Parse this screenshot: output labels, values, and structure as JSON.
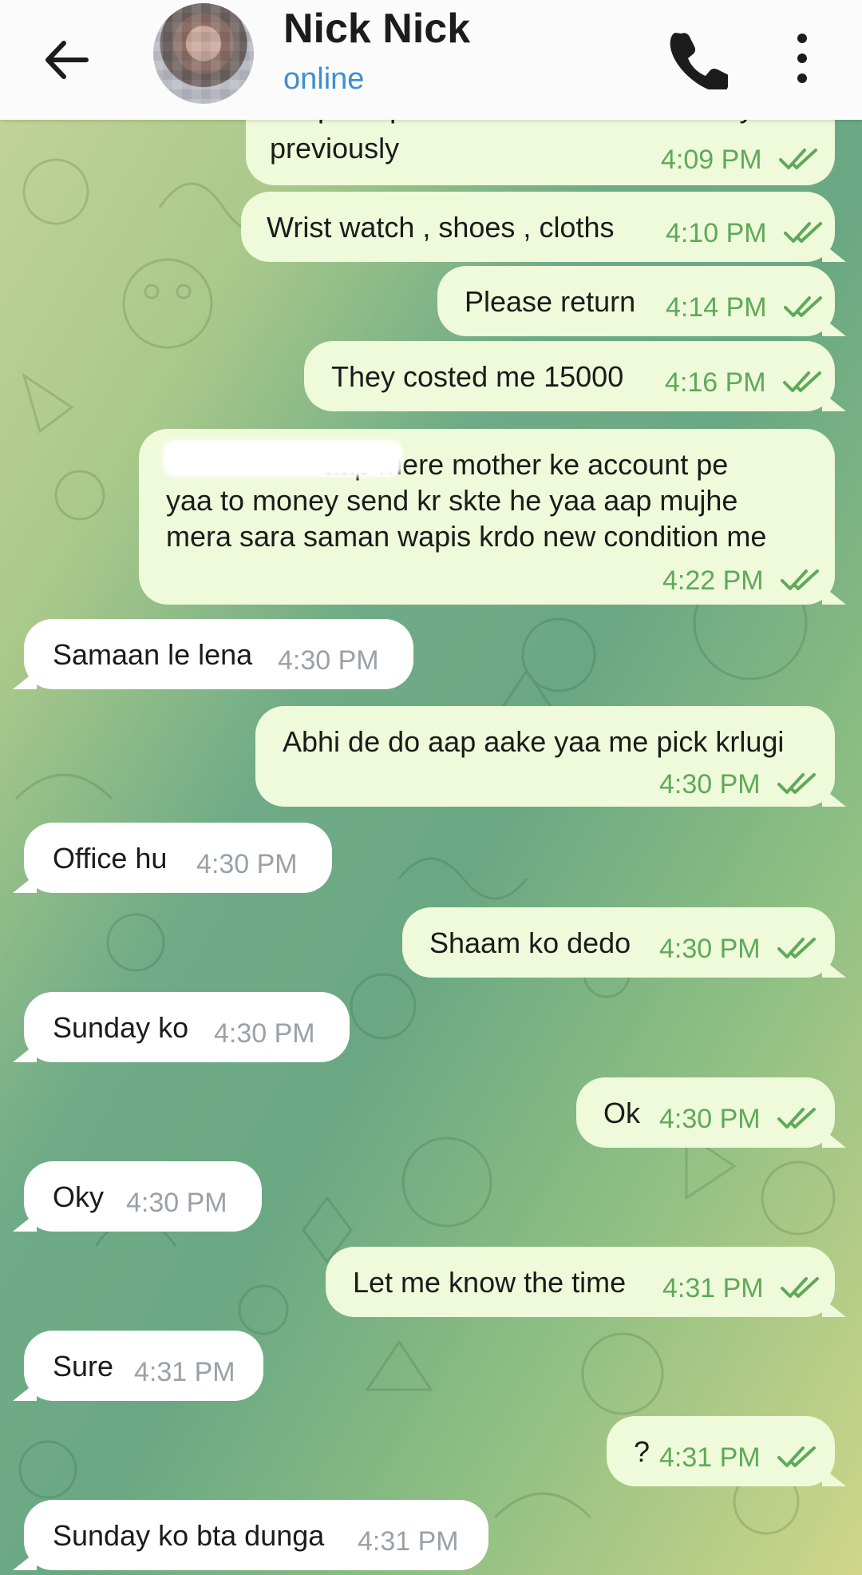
{
  "header": {
    "contact_name": "Nick Nick",
    "contact_status": "online",
    "icons": [
      "back-arrow-icon",
      "avatar",
      "phone-icon",
      "more-vertical-icon"
    ]
  },
  "messages": [
    {
      "dir": "out",
      "lines": [
        "I hope aapne use nhi kia he as told by u",
        "previously"
      ],
      "time": "4:09 PM"
    },
    {
      "dir": "out",
      "lines": [
        "Wrist watch , shoes , cloths"
      ],
      "time": "4:10 PM"
    },
    {
      "dir": "out",
      "lines": [
        "Please return"
      ],
      "time": "4:14 PM"
    },
    {
      "dir": "out",
      "lines": [
        "They costed me 15000"
      ],
      "time": "4:16 PM"
    },
    {
      "dir": "out",
      "lines": [
        "aap mere mother ke account pe",
        "yaa to money send kr skte he yaa aap mujhe",
        "mera sara saman wapis krdo new condition me"
      ],
      "time": "4:22 PM"
    },
    {
      "dir": "in",
      "lines": [
        "Samaan le lena"
      ],
      "time": "4:30 PM"
    },
    {
      "dir": "out",
      "lines": [
        "Abhi de do aap aake yaa me pick krlugi"
      ],
      "time": "4:30 PM"
    },
    {
      "dir": "in",
      "lines": [
        "Office hu"
      ],
      "time": "4:30 PM"
    },
    {
      "dir": "out",
      "lines": [
        "Shaam ko dedo"
      ],
      "time": "4:30 PM"
    },
    {
      "dir": "in",
      "lines": [
        "Sunday ko"
      ],
      "time": "4:30 PM"
    },
    {
      "dir": "out",
      "lines": [
        "Ok"
      ],
      "time": "4:30 PM"
    },
    {
      "dir": "in",
      "lines": [
        "Oky"
      ],
      "time": "4:30 PM"
    },
    {
      "dir": "out",
      "lines": [
        "Let me know the time"
      ],
      "time": "4:31 PM"
    },
    {
      "dir": "in",
      "lines": [
        "Sure"
      ],
      "time": "4:31 PM"
    },
    {
      "dir": "out",
      "lines": [
        "?"
      ],
      "time": "4:31 PM"
    },
    {
      "dir": "in",
      "lines": [
        "Sunday ko bta dunga"
      ],
      "time": "4:31 PM"
    }
  ],
  "colors": {
    "outgoing_bubble": "#eefad9",
    "incoming_bubble": "#ffffff",
    "read_check": "#5fa95a",
    "status_online": "#3d8fd0"
  }
}
